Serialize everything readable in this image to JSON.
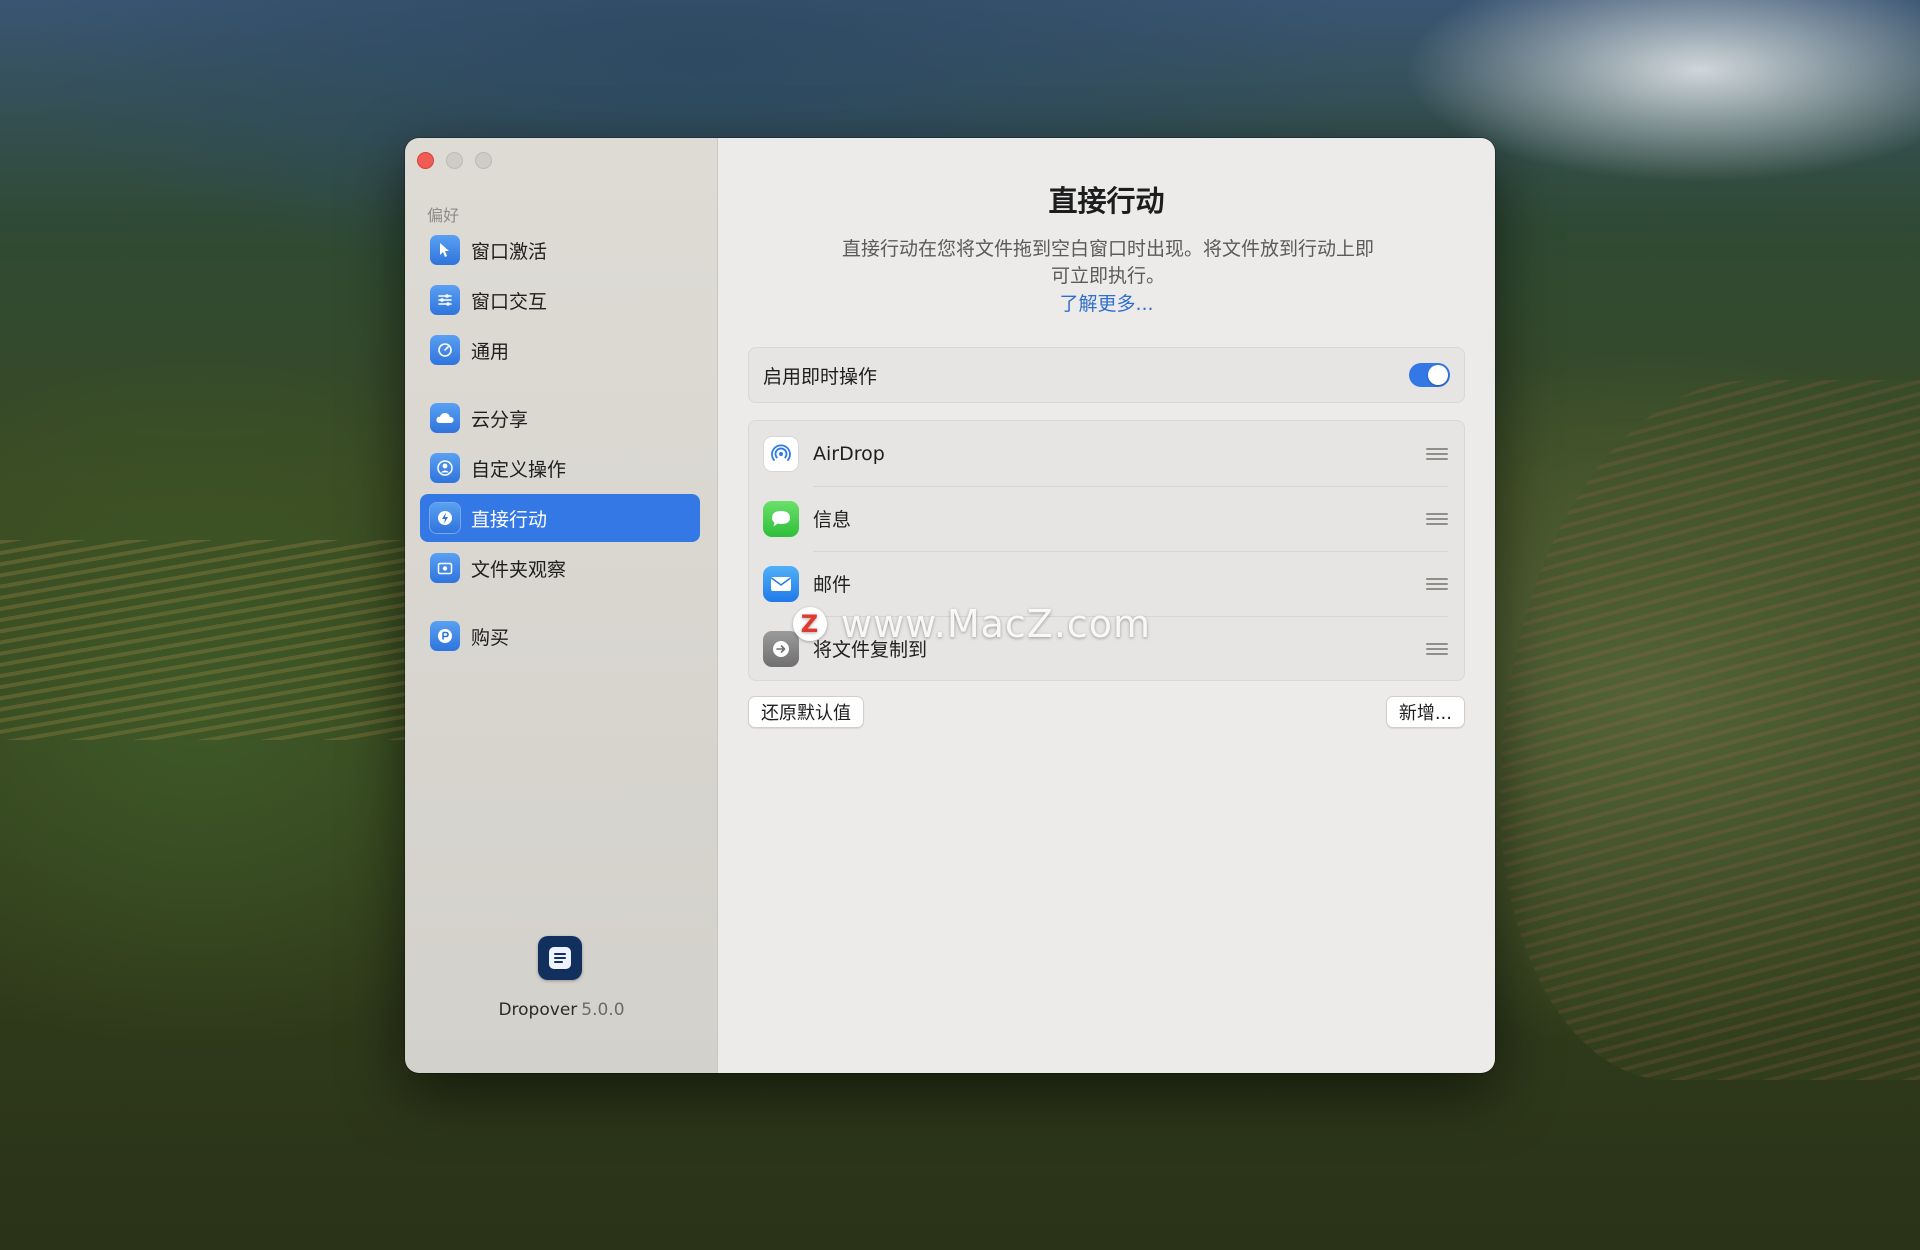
{
  "window": {
    "title": "直接行动",
    "description": "直接行动在您将文件拖到空白窗口时出现。将文件放到行动上即可立即执行。",
    "learn_more": "了解更多..."
  },
  "sidebar": {
    "section_label": "偏好",
    "items": [
      {
        "label": "窗口激活",
        "icon": "cursor-icon"
      },
      {
        "label": "窗口交互",
        "icon": "sliders-icon"
      },
      {
        "label": "通用",
        "icon": "gauge-icon"
      },
      {
        "label": "云分享",
        "icon": "cloud-icon"
      },
      {
        "label": "自定义操作",
        "icon": "person-icon"
      },
      {
        "label": "直接行动",
        "icon": "bolt-icon",
        "active": true
      },
      {
        "label": "文件夹观察",
        "icon": "folder-eye-icon"
      },
      {
        "label": "购买",
        "icon": "coin-icon"
      }
    ],
    "app_name": "Dropover",
    "app_version": "5.0.0"
  },
  "toggle": {
    "label": "启用即时操作",
    "enabled": true
  },
  "actions": [
    {
      "label": "AirDrop",
      "icon": "airdrop-icon"
    },
    {
      "label": "信息",
      "icon": "messages-icon"
    },
    {
      "label": "邮件",
      "icon": "mail-icon"
    },
    {
      "label": "将文件复制到",
      "icon": "copy-to-icon"
    }
  ],
  "buttons": {
    "reset": "还原默认值",
    "add": "新增..."
  },
  "watermark": {
    "text": "www.MacZ.com",
    "logo_letter": "Z"
  },
  "colors": {
    "accent": "#3478e6",
    "link": "#2f6fd0",
    "close": "#ee5c53"
  }
}
